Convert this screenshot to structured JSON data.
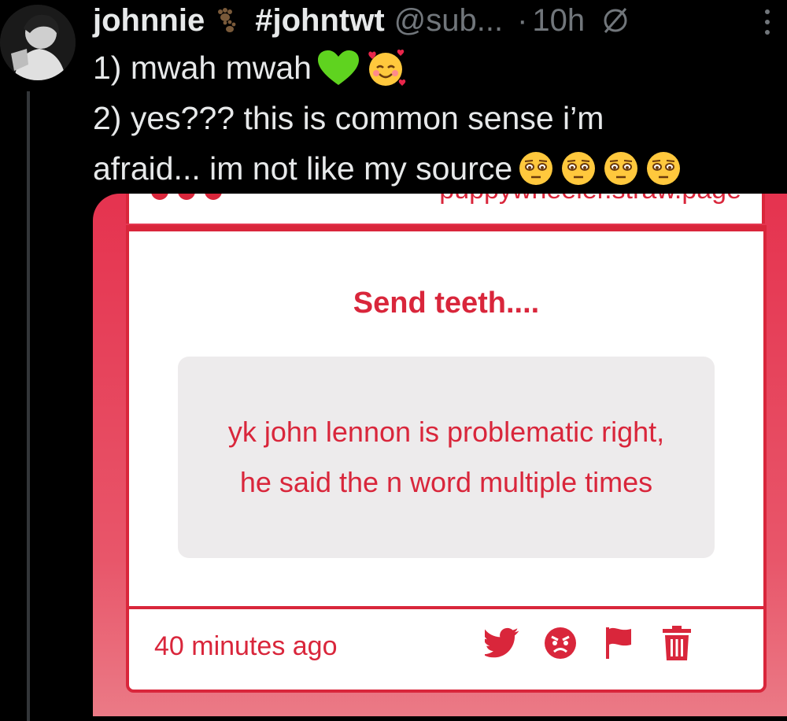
{
  "tweet": {
    "display_name": "johnnie",
    "hashtag": "#johntwt",
    "handle": "@sub...",
    "separator": "·",
    "time": "10h",
    "line1": "1) mwah mwah",
    "line2": "2) yes??? this is common sense i’m",
    "line3": "afraid... im not like my source",
    "icons": [
      "paw-prints-icon",
      "green-heart-icon",
      "smiling-face-with-hearts-icon",
      "pleading-face-icon",
      "more-options-icon"
    ]
  },
  "card": {
    "site_url": "puppywheeler.straw.page",
    "prompt": "Send teeth....",
    "question": "yk john lennon is problematic right, he said the n word multiple times",
    "timestamp": "40 minutes ago",
    "actions": [
      "twitter-bird-icon",
      "angry-face-icon",
      "flag-icon",
      "trash-icon"
    ],
    "colors": {
      "accent": "#d9263b",
      "card_bg": "#e5334f",
      "question_bg": "#edebec"
    }
  }
}
